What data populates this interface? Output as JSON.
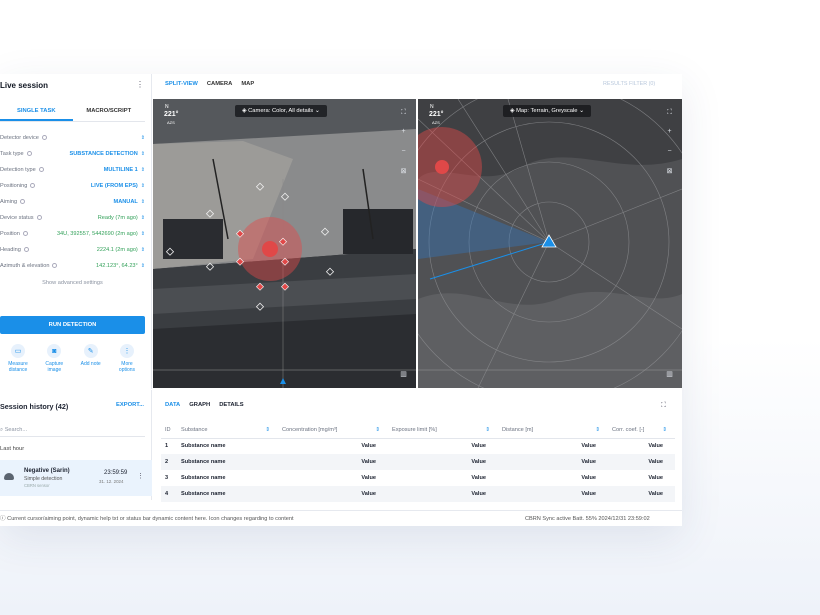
{
  "left": {
    "title": "Live session",
    "tabs": [
      "SINGLE TASK",
      "MACRO/SCRIPT"
    ],
    "rows": [
      {
        "label": "Detector device",
        "value": ""
      },
      {
        "label": "Task type",
        "value": "SUBSTANCE DETECTION"
      },
      {
        "label": "Detection type",
        "value": "MULTILINE 1"
      },
      {
        "label": "Positioning",
        "value": "LIVE (FROM EPS)"
      },
      {
        "label": "Aiming",
        "value": "MANUAL"
      },
      {
        "label": "Device status",
        "value": "Ready (7m ago)"
      },
      {
        "label": "Position",
        "value": "34U, 392557, 5442690 (2m ago)"
      },
      {
        "label": "Heading",
        "value": "2224.1 (2m ago)"
      },
      {
        "label": "Azimuth & elevation",
        "value": "142.123°, 64.23°"
      }
    ],
    "advanced": "Show advanced settings",
    "run": "RUN DETECTION",
    "actions": [
      {
        "icon": "ruler-icon",
        "label": "Measure distance"
      },
      {
        "icon": "camera-icon",
        "label": "Capture image"
      },
      {
        "icon": "pencil-icon",
        "label": "Add note"
      },
      {
        "icon": "more-icon",
        "label": "More options"
      }
    ]
  },
  "views": {
    "tabs": [
      "SPLIT-VIEW",
      "CAMERA",
      "MAP"
    ],
    "results_filter": "RESULTS FILTER (0)",
    "camera": {
      "heading": "221°",
      "heading_label": "AZS",
      "dropdown_label": "Camera:",
      "dropdown_value": "Color, All details"
    },
    "map": {
      "heading": "221°",
      "heading_label": "AZS",
      "dropdown_label": "Map:",
      "dropdown_value": "Terrain, Greyscale"
    }
  },
  "history": {
    "title": "Session history (42)",
    "export": "EXPORT...",
    "search_placeholder": "Search...",
    "group": "Last hour",
    "item": {
      "name": "Negative (Sarin)",
      "sub": "Simple detection",
      "sub2": "CBRN sensor",
      "time": "23:59:59",
      "date": "31. 12. 2024"
    }
  },
  "table": {
    "tabs": [
      "DATA",
      "GRAPH",
      "DETAILS"
    ],
    "headers": [
      "ID",
      "Substance",
      "Concentration [mg/m³]",
      "Exposure limit [%]",
      "Distance [m]",
      "Corr. coef. [-]"
    ],
    "rows": [
      [
        "1",
        "Substance name",
        "Value",
        "Value",
        "Value",
        "Value"
      ],
      [
        "2",
        "Substance name",
        "Value",
        "Value",
        "Value",
        "Value"
      ],
      [
        "3",
        "Substance name",
        "Value",
        "Value",
        "Value",
        "Value"
      ],
      [
        "4",
        "Substance name",
        "Value",
        "Value",
        "Value",
        "Value"
      ]
    ]
  },
  "status": {
    "left": "Current cursor/aiming point, dynamic help txt or status bar dynamic content here. Icon changes regarding to content",
    "right": "CBRN Sync active   Batt. 55%   2024/12/31   23:59:02"
  }
}
